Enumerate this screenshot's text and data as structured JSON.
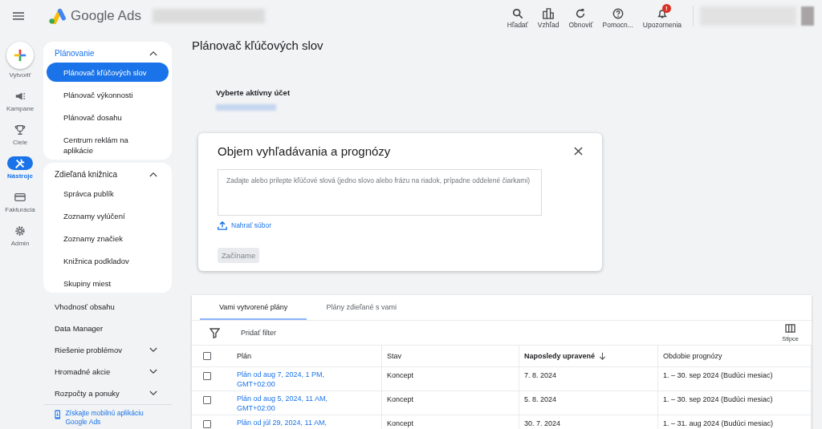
{
  "header": {
    "logo_text": "Google Ads",
    "actions": [
      {
        "kind": "search",
        "label": "Hľadať"
      },
      {
        "kind": "view",
        "label": "Vzhľad"
      },
      {
        "kind": "refresh",
        "label": "Obnoviť"
      },
      {
        "kind": "help",
        "label": "Pomocn..."
      },
      {
        "kind": "bell",
        "label": "Upozornenia",
        "badge": "!"
      }
    ]
  },
  "rail": {
    "create_label": "Vytvoriť",
    "items": [
      {
        "kind": "campaigns",
        "label": "Kampane",
        "selected": false
      },
      {
        "kind": "goals",
        "label": "Ciele",
        "selected": false
      },
      {
        "kind": "tools",
        "label": "Nástroje",
        "selected": true
      },
      {
        "kind": "billing",
        "label": "Fakturácia",
        "selected": false
      },
      {
        "kind": "admin",
        "label": "Admin",
        "selected": false
      }
    ]
  },
  "sidebar": {
    "groups": [
      {
        "title": "Plánovanie",
        "active": true,
        "expanded": true,
        "items": [
          {
            "label": "Plánovač kľúčových slov",
            "selected": true
          },
          {
            "label": "Plánovač výkonnosti",
            "selected": false
          },
          {
            "label": "Plánovač dosahu",
            "selected": false
          },
          {
            "label": "Centrum reklám na aplikácie",
            "selected": false
          }
        ]
      },
      {
        "title": "Zdieľaná knižnica",
        "active": false,
        "expanded": true,
        "items": [
          {
            "label": "Správca publík",
            "selected": false
          },
          {
            "label": "Zoznamy vylúčení",
            "selected": false
          },
          {
            "label": "Zoznamy značiek",
            "selected": false
          },
          {
            "label": "Knižnica podkladov",
            "selected": false
          },
          {
            "label": "Skupiny miest",
            "selected": false
          }
        ]
      }
    ],
    "links": [
      {
        "label": "Vhodnosť obsahu",
        "expandable": false
      },
      {
        "label": "Data Manager",
        "expandable": false
      },
      {
        "label": "Riešenie problémov",
        "expandable": true
      },
      {
        "label": "Hromadné akcie",
        "expandable": true
      },
      {
        "label": "Rozpočty a ponuky",
        "expandable": true
      }
    ],
    "footer_link": "Získajte mobilnú aplikáciu Google Ads"
  },
  "page_title": "Plánovač kľúčových slov",
  "account_label": "Vyberte aktívny účet",
  "modal": {
    "title": "Objem vyhľadávania a prognózy",
    "placeholder": "Zadajte alebo prilepte kľúčové slová (jedno slovo alebo frázu na riadok, prípadne oddelené čiarkami)",
    "upload": "Nahrať súbor",
    "button": {
      "label": "Začíname",
      "disabled": true
    }
  },
  "plans": {
    "tabs": [
      {
        "label": "Vami vytvorené plány",
        "selected": true
      },
      {
        "label": "Plány zdieľané s vami",
        "selected": false
      }
    ],
    "select_all_checked": false,
    "filter": "Pridať filter",
    "columns_button": "Stĺpce",
    "columns": [
      {
        "label": "Plán",
        "sorted": false
      },
      {
        "label": "Stav",
        "sorted": false
      },
      {
        "label": "Naposledy upravené",
        "sorted": true
      },
      {
        "label": "Obdobie prognózy",
        "sorted": false
      }
    ],
    "rows": [
      {
        "checked": false,
        "plan": "Plán od aug 7, 2024, 1 PM, GMT+02:00",
        "status": "Koncept",
        "modified": "7. 8. 2024",
        "period": "1. – 30. sep 2024 (Budúci mesiac)"
      },
      {
        "checked": false,
        "plan": "Plán od aug 5, 2024, 11 AM, GMT+02:00",
        "status": "Koncept",
        "modified": "5. 8. 2024",
        "period": "1. – 30. sep 2024 (Budúci mesiac)"
      },
      {
        "checked": false,
        "plan": "Plán od júl 29, 2024, 11 AM,",
        "status": "Koncept",
        "modified": "30. 7. 2024",
        "period": "1. – 31. aug 2024 (Budúci mesiac)"
      }
    ]
  }
}
